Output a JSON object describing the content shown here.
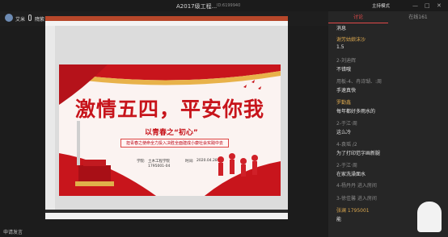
{
  "window": {
    "title": "A2017级工程...",
    "id": "ID:6199940",
    "controls": [
      "—",
      "□",
      "✕"
    ]
  },
  "presenter": {
    "name1": "艾米",
    "name2": "隋紫"
  },
  "slide": {
    "headline": "激情五四，平安你我",
    "subtitle": "以青春之“初心”",
    "band": "担青春之使命全力投入决胜全面建成小康社会实践中去",
    "meta1_label": "学院:",
    "meta1_value": "土木工程学院",
    "meta1_code": "1795001-04",
    "meta2_label": "时间:",
    "meta2_value": "2020.04.28"
  },
  "sidebar": {
    "tab_chat": "讨论",
    "tab_online": "在线161",
    "host_mode": "主持模式",
    "messages": [
      {
        "name": "",
        "text": "消息"
      },
      {
        "name": "谢芳姑娘沫沙",
        "text": "1.5"
      },
      {
        "name": "2-刘迪辉",
        "text": "不错哦"
      },
      {
        "name": "用板-4、冉诗瑚、:周",
        "text": "手速真快"
      },
      {
        "name": "罗勤鑫",
        "text": "每年都好多雨水的"
      },
      {
        "name": "2-于江·周",
        "text": "这么冷"
      },
      {
        "name": "4-袁瑶 /2",
        "text": "为了打印范字画新腿"
      },
      {
        "name": "2-于江·周",
        "text": "在家洗澡面水"
      },
      {
        "name": "4-杨丹丹 进入房间",
        "text": ""
      },
      {
        "name": "3-徐佳馨 进入房间",
        "text": ""
      },
      {
        "name": "张澜 1795001",
        "text": "能"
      }
    ]
  },
  "bottom": {
    "label": "申请发言"
  }
}
